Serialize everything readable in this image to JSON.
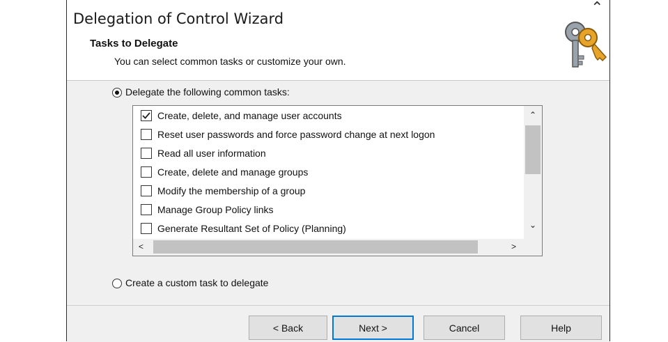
{
  "window": {
    "title": "Delegation of Control Wizard"
  },
  "header": {
    "heading": "Tasks to Delegate",
    "subtitle": "You can select common tasks or customize your own."
  },
  "options": {
    "common_tasks": {
      "label": "Delegate the following common tasks:",
      "selected": true
    },
    "custom_task": {
      "label": "Create a custom task to delegate",
      "selected": false
    }
  },
  "tasks": [
    {
      "label": "Create, delete, and manage user accounts",
      "checked": true
    },
    {
      "label": "Reset user passwords and force password change at next logon",
      "checked": false
    },
    {
      "label": "Read all user information",
      "checked": false
    },
    {
      "label": "Create, delete and manage groups",
      "checked": false
    },
    {
      "label": "Modify the membership of a group",
      "checked": false
    },
    {
      "label": "Manage Group Policy links",
      "checked": false
    },
    {
      "label": "Generate Resultant Set of Policy (Planning)",
      "checked": false
    }
  ],
  "buttons": {
    "back": "< Back",
    "next": "Next >",
    "cancel": "Cancel",
    "help": "Help"
  },
  "colors": {
    "accent": "#0078d7",
    "panel": "#f0f0f0"
  },
  "icons": [
    "keys-icon",
    "close-chevron-icon",
    "scroll-up-icon",
    "scroll-down-icon",
    "scroll-left-icon",
    "scroll-right-icon"
  ]
}
